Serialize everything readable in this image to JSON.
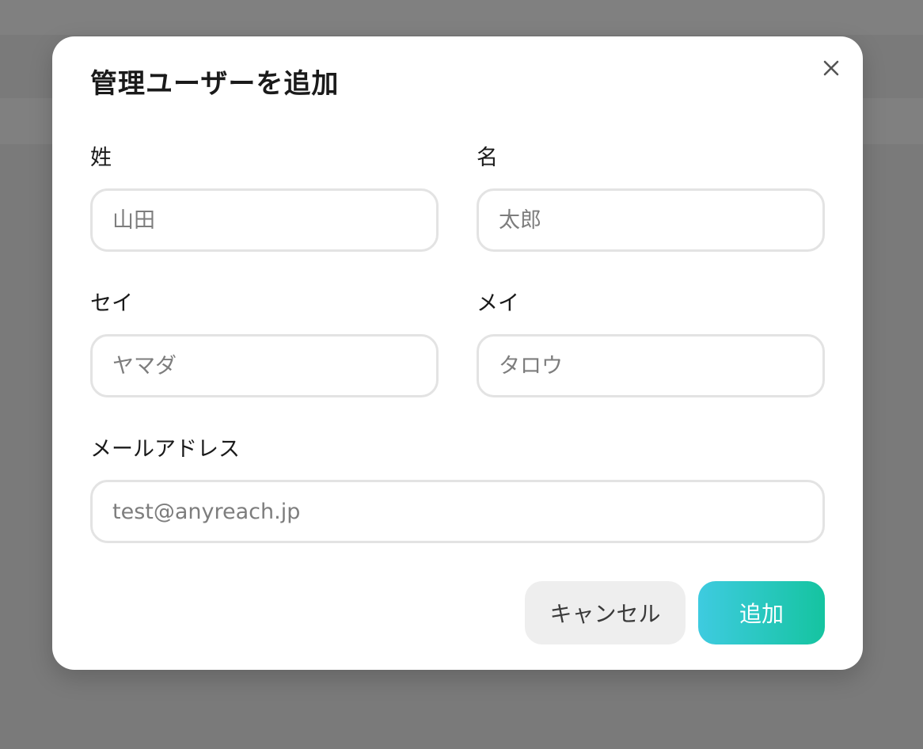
{
  "modal": {
    "title": "管理ユーザーを追加",
    "close_icon": "close-icon"
  },
  "form": {
    "last_name": {
      "label": "姓",
      "placeholder": "山田",
      "value": ""
    },
    "first_name": {
      "label": "名",
      "placeholder": "太郎",
      "value": ""
    },
    "last_name_kana": {
      "label": "セイ",
      "placeholder": "ヤマダ",
      "value": ""
    },
    "first_name_kana": {
      "label": "メイ",
      "placeholder": "タロウ",
      "value": ""
    },
    "email": {
      "label": "メールアドレス",
      "placeholder": "test@anyreach.jp",
      "value": ""
    }
  },
  "actions": {
    "cancel_label": "キャンセル",
    "submit_label": "追加"
  },
  "colors": {
    "backdrop": "#7a7a7a",
    "submit_gradient_start": "#3ecbe0",
    "submit_gradient_end": "#15c4a0",
    "cancel_bg": "#eeeeee",
    "input_border": "#e3e3e3"
  }
}
